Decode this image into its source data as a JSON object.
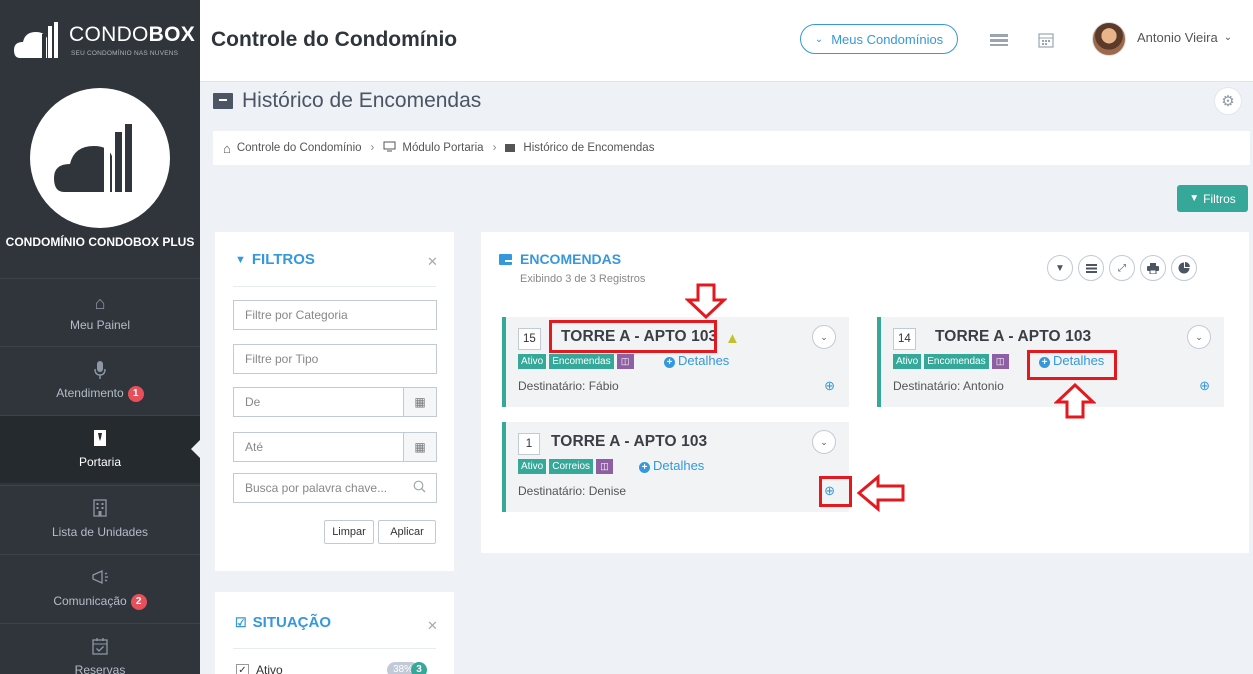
{
  "header": {
    "logo_brand_light": "CONDO",
    "logo_brand_bold": "BOX",
    "logo_tagline": "SEU CONDOMÍNIO NAS NUVENS",
    "title": "Controle do Condomínio",
    "condos_button": "Meus Condomínios",
    "user_name": "Antonio Vieira"
  },
  "sidebar": {
    "condo_name": "CONDOMÍNIO CONDOBOX PLUS",
    "items": [
      {
        "label": "Meu Painel",
        "icon": "home-icon"
      },
      {
        "label": "Atendimento",
        "icon": "microphone-icon",
        "badge": "1"
      },
      {
        "label": "Portaria",
        "icon": "doorman-icon",
        "active": true
      },
      {
        "label": "Lista de Unidades",
        "icon": "building-icon"
      },
      {
        "label": "Comunicação",
        "icon": "megaphone-icon",
        "badge": "2"
      },
      {
        "label": "Reservas",
        "icon": "calendar-check-icon"
      }
    ]
  },
  "page": {
    "title": "Histórico de Encomendas",
    "breadcrumb": [
      "Controle do Condomínio",
      "Módulo Portaria",
      "Histórico de Encomendas"
    ],
    "filters_button": "Filtros"
  },
  "filters": {
    "title": "FILTROS",
    "category_placeholder": "Filtre por Categoria",
    "type_placeholder": "Filtre por Tipo",
    "from_placeholder": "De",
    "to_placeholder": "Até",
    "keyword_placeholder": "Busca por palavra chave...",
    "clear_label": "Limpar",
    "apply_label": "Aplicar"
  },
  "situacao": {
    "title": "SITUAÇÃO",
    "items": [
      {
        "label": "Ativo",
        "percent": "38%",
        "count": "3",
        "checked": true
      }
    ]
  },
  "encomendas": {
    "title": "ENCOMENDAS",
    "subtitle": "Exibindo 3 de 3 Registros",
    "details_label": "Detalhes",
    "cards": [
      {
        "number": "15",
        "title": "TORRE A - APTO 103",
        "warning": true,
        "status": "Ativo",
        "category": "Encomendas",
        "recipient": "Destinatário: Fábio"
      },
      {
        "number": "14",
        "title": "TORRE A - APTO 103",
        "warning": false,
        "status": "Ativo",
        "category": "Encomendas",
        "recipient": "Destinatário: Antonio"
      },
      {
        "number": "1",
        "title": "TORRE A - APTO 103",
        "warning": false,
        "status": "Ativo",
        "category": "Correios",
        "recipient": "Destinatário: Denise"
      }
    ]
  },
  "colors": {
    "sidebar_bg": "#2f353b",
    "accent_blue": "#3598dc",
    "accent_teal": "#36a89a",
    "annotation_red": "#e3191f",
    "badge_red": "#e7505a",
    "tag_purple": "#8e5fa2"
  }
}
